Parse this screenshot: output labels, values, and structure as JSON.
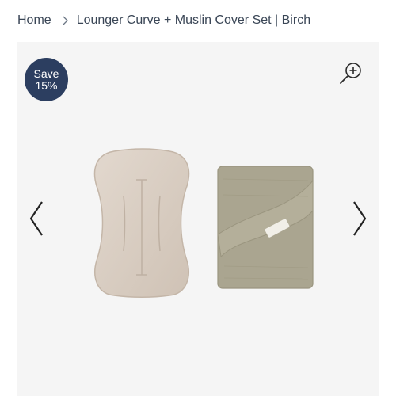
{
  "breadcrumb": {
    "home": "Home",
    "current": "Lounger Curve + Muslin Cover Set | Birch"
  },
  "badge": {
    "line1": "Save",
    "line2": "15%"
  },
  "icons": {
    "separator": "chevron-right-icon",
    "zoom": "zoom-in-icon",
    "prev": "chevron-left-icon",
    "next": "chevron-right-icon"
  },
  "colors": {
    "badge_bg": "#2c3e60",
    "gallery_bg": "#f5f5f5",
    "text": "#3a4656",
    "lounger": "#d9cec3",
    "muslin": "#a9a48f"
  }
}
